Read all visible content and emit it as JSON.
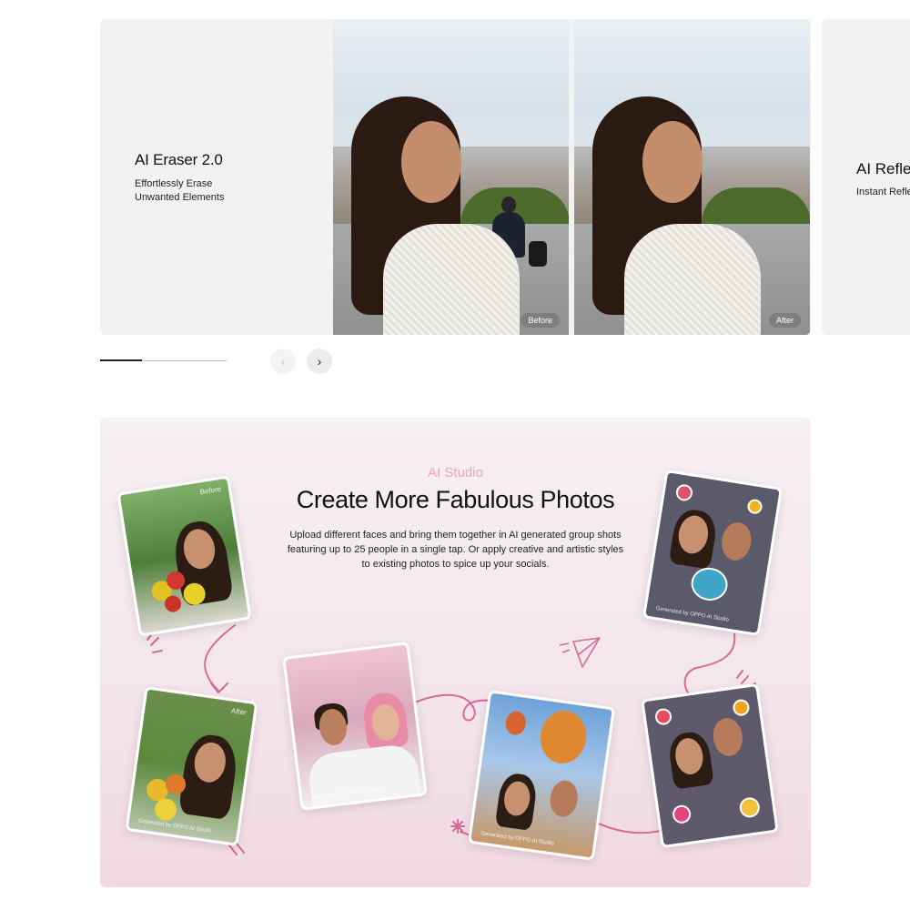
{
  "carousel": {
    "slide": {
      "title": "AI Eraser 2.0",
      "subtitle": "Effortlessly Erase Unwanted Elements",
      "before_label": "Before",
      "after_label": "After"
    },
    "next_slide": {
      "title": "AI Refle",
      "subtitle": "Instant Refle"
    },
    "progress": 0.33,
    "prev_icon": "chevron-left-icon",
    "next_icon": "chevron-right-icon",
    "prev_glyph": "‹",
    "next_glyph": "›"
  },
  "studio": {
    "eyebrow": "AI Studio",
    "title": "Create More Fabulous Photos",
    "description": "Upload different faces and bring them together in AI generated group shots featuring up to 25 people in a single tap. Or apply creative and artistic styles to existing photos to spice up your socials.",
    "cards": {
      "before_tag": "Before",
      "after_tag": "After",
      "caption": "Generated by OPPO AI Studio"
    }
  },
  "colors": {
    "accent_pink": "#e8a3c0",
    "doodle_pink": "#d86a95",
    "studio_bg": "#f3e6ec"
  }
}
